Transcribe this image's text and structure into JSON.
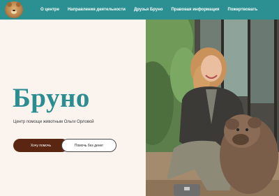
{
  "header": {
    "logo_icon": "bear-face-logo-icon",
    "nav": [
      {
        "label": "О центре"
      },
      {
        "label": "Направления деятельности"
      },
      {
        "label": "Друзья Бруно"
      },
      {
        "label": "Правовая информация"
      },
      {
        "label": "Пожертвовать"
      }
    ],
    "bar_color": "#2c8f92"
  },
  "hero": {
    "title": "Бруно",
    "subtitle": "Центр помощи животным Ольги Орловой",
    "primary_button": "Хочу помочь",
    "secondary_button": "Помочь без денег",
    "accent_color": "#2b8d90",
    "primary_button_color": "#5a2611"
  },
  "photo": {
    "subject": "woman-with-dog-photo"
  }
}
